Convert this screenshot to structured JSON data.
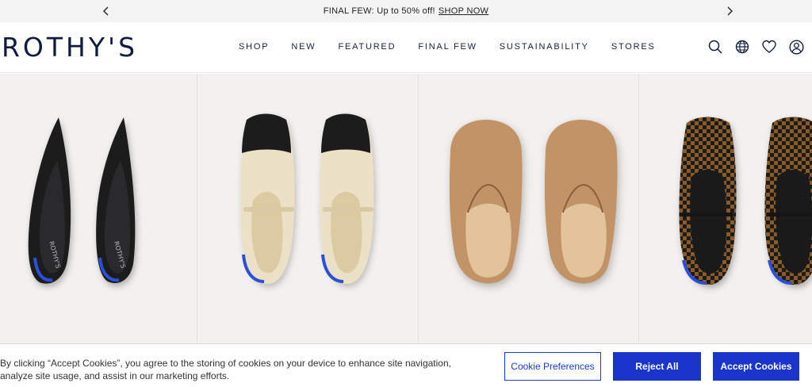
{
  "announcement": {
    "text": "FINAL FEW: Up to 50% off!",
    "link": "SHOP NOW"
  },
  "header": {
    "logo": "ROTHY'S",
    "nav": [
      "SHOP",
      "NEW",
      "FEATURED",
      "FINAL FEW",
      "SUSTAINABILITY",
      "STORES"
    ],
    "icons": [
      "search-icon",
      "globe-icon",
      "heart-icon",
      "account-icon"
    ]
  },
  "products": [
    {
      "style": "pointed-flat",
      "color": "black"
    },
    {
      "style": "mary-jane",
      "color": "cream-black-toe"
    },
    {
      "style": "mule",
      "color": "camel"
    },
    {
      "style": "mary-jane-checker",
      "color": "brown-black-check"
    }
  ],
  "colors": {
    "navy": "#0f1c3f",
    "accent_blue": "#1a35c9",
    "card_bg": "#f2f1ef"
  },
  "cookie_banner": {
    "message": "By clicking “Accept Cookies”, you agree to the storing of cookies on your device to enhance site navigation, analyze site usage, and assist in our marketing efforts.",
    "preferences_label": "Cookie Preferences",
    "reject_label": "Reject All",
    "accept_label": "Accept Cookies"
  }
}
